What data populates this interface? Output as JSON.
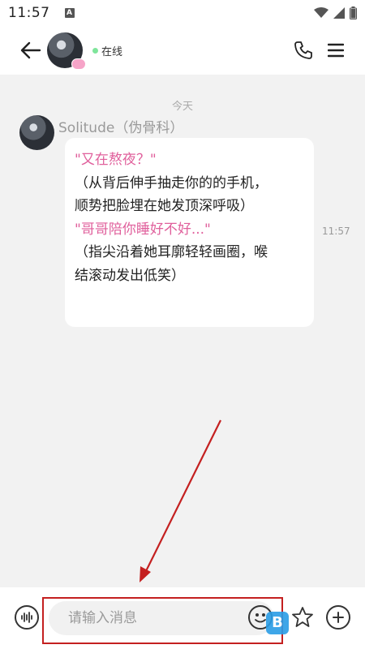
{
  "status_bar": {
    "time": "11:57",
    "notification_letter": "A"
  },
  "header": {
    "contact_status": "在线"
  },
  "chat": {
    "date_label": "今天",
    "messages": [
      {
        "sender": "Solitude（伪骨科）",
        "time": "11:57",
        "lines": [
          "\"又在熬夜？\"",
          "（从背后伸手抽走你的的手机，",
          "顺势把脸埋在她发顶深呼吸）",
          "\"哥哥陪你睡好不好...\"",
          "（指尖沿着她耳廓轻轻画圈，喉",
          "结滚动发出低笑）"
        ]
      }
    ]
  },
  "input_bar": {
    "placeholder": "请输入消息"
  },
  "colors": {
    "accent_pink": "#e0609c",
    "online_green": "#7fe59b",
    "annotation_red": "#c42020"
  },
  "icons": [
    "back-arrow-icon",
    "phone-icon",
    "menu-icon",
    "voice-icon",
    "emoji-icon",
    "sticker-icon",
    "plus-icon"
  ]
}
